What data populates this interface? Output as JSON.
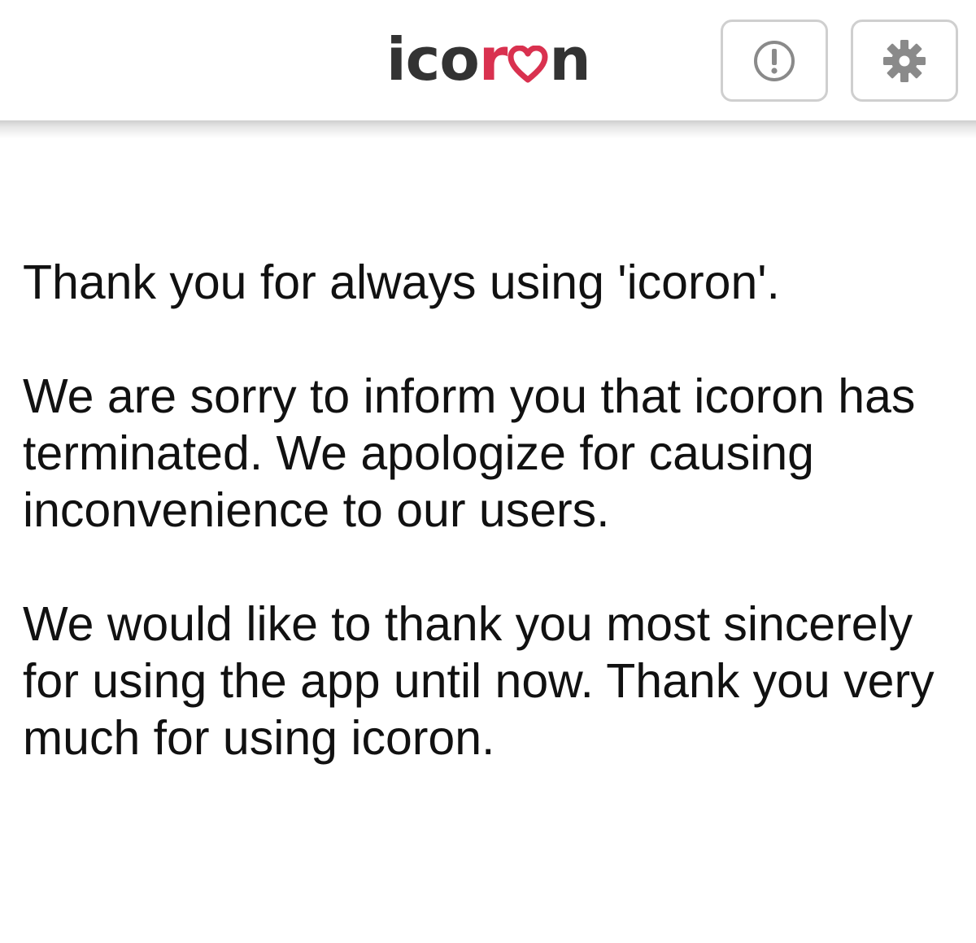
{
  "header": {
    "logo": {
      "part1": "ico",
      "part2": "r",
      "part3": "n",
      "heart_color": "#d9314f",
      "text_color": "#333333"
    },
    "info_button": {
      "icon": "exclamation-circle-icon"
    },
    "settings_button": {
      "icon": "gear-icon"
    }
  },
  "notice": {
    "paragraph1": "Thank you for always using 'icoron'.",
    "paragraph2": "We are sorry to inform you that icoron has terminated. We apologize for causing inconvenience to our users.",
    "paragraph3": "We would like to thank you most sincerely for using the app until now. Thank you very much for using icoron."
  }
}
